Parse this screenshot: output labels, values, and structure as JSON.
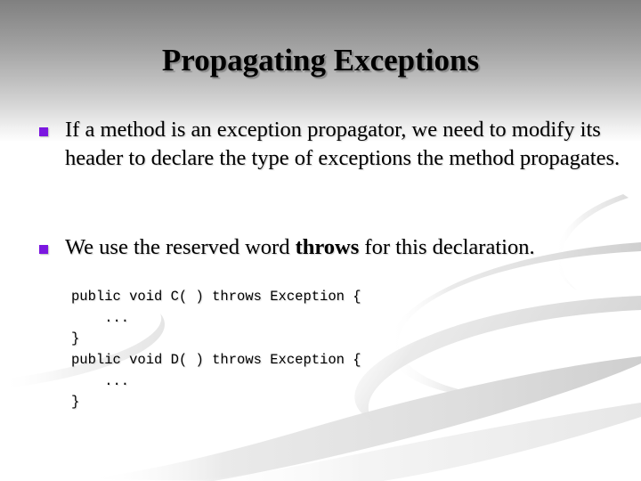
{
  "slide": {
    "title": "Propagating Exceptions",
    "background": {
      "gradient_top_color": "#808080",
      "gradient_bottom_color": "#ffffff",
      "body_color": "#ffffff",
      "swoosh_color": "#e3e3e3"
    },
    "accent_color": "#7B17E0",
    "bullets": [
      {
        "marker": "square-bullet",
        "text_runs": [
          {
            "text": "If a method is an exception propagator, we need to modify its header to declare the type of exceptions the method propagates.",
            "bold": false
          }
        ]
      },
      {
        "marker": "square-bullet",
        "text_runs": [
          {
            "text": "We use the reserved word ",
            "bold": false
          },
          {
            "text": "throws",
            "bold": true
          },
          {
            "text": " for this declaration.",
            "bold": false
          }
        ]
      }
    ],
    "code_blocks": [
      {
        "lines": [
          "public void C( ) throws Exception {",
          "    ...",
          "}"
        ]
      },
      {
        "lines": [
          "public void D( ) throws Exception {",
          "    ...",
          "}"
        ]
      }
    ]
  }
}
